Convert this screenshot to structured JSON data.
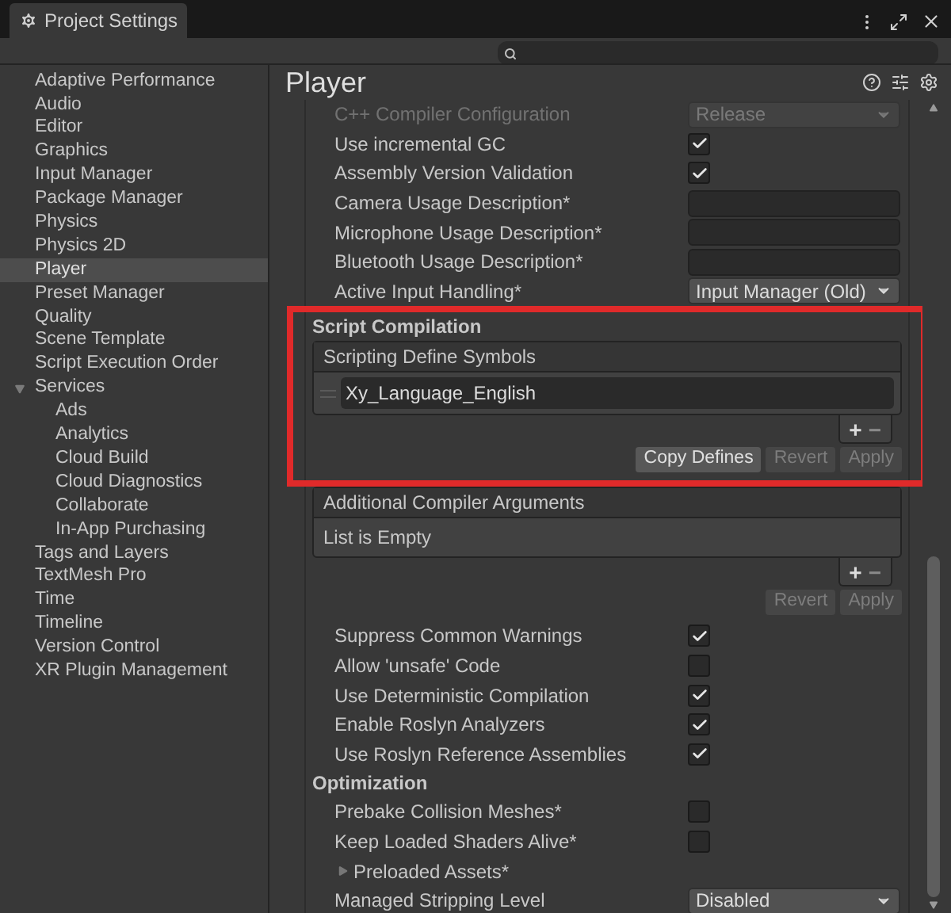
{
  "window": {
    "title": "Project Settings"
  },
  "sidebar": {
    "items": [
      {
        "label": "Adaptive Performance",
        "selected": false
      },
      {
        "label": "Audio",
        "selected": false
      },
      {
        "label": "Editor",
        "selected": false
      },
      {
        "label": "Graphics",
        "selected": false
      },
      {
        "label": "Input Manager",
        "selected": false
      },
      {
        "label": "Package Manager",
        "selected": false
      },
      {
        "label": "Physics",
        "selected": false
      },
      {
        "label": "Physics 2D",
        "selected": false
      },
      {
        "label": "Player",
        "selected": true
      },
      {
        "label": "Preset Manager",
        "selected": false
      },
      {
        "label": "Quality",
        "selected": false
      },
      {
        "label": "Scene Template",
        "selected": false
      },
      {
        "label": "Script Execution Order",
        "selected": false
      },
      {
        "label": "Services",
        "selected": false,
        "expanded": true,
        "children": [
          {
            "label": "Ads",
            "selected": false
          },
          {
            "label": "Analytics",
            "selected": false
          },
          {
            "label": "Cloud Build",
            "selected": false
          },
          {
            "label": "Cloud Diagnostics",
            "selected": false
          },
          {
            "label": "Collaborate",
            "selected": false
          },
          {
            "label": "In-App Purchasing",
            "selected": false
          }
        ]
      },
      {
        "label": "Tags and Layers",
        "selected": false
      },
      {
        "label": "TextMesh Pro",
        "selected": false
      },
      {
        "label": "Time",
        "selected": false
      },
      {
        "label": "Timeline",
        "selected": false
      },
      {
        "label": "Version Control",
        "selected": false
      },
      {
        "label": "XR Plugin Management",
        "selected": false
      }
    ]
  },
  "content": {
    "title": "Player",
    "sections": [
      {
        "highlighted": false,
        "rows": [
          {
            "kind": "dropdown",
            "label": "C++ Compiler Configuration",
            "value": "Release",
            "disabled": true
          },
          {
            "kind": "checkbox",
            "label": "Use incremental GC",
            "checked": true
          },
          {
            "kind": "checkbox",
            "label": "Assembly Version Validation",
            "checked": true
          },
          {
            "kind": "text",
            "label": "Camera Usage Description*"
          },
          {
            "kind": "text",
            "label": "Microphone Usage Description*"
          },
          {
            "kind": "text",
            "label": "Bluetooth Usage Description*"
          },
          {
            "kind": "dropdown",
            "label": "Active Input Handling*",
            "value": "Input Manager (Old)",
            "disabled": false
          }
        ]
      },
      {
        "highlighted": true,
        "rows": [
          {
            "kind": "heading",
            "label": "Script Compilation"
          },
          {
            "kind": "list",
            "label": "Scripting Define Symbols",
            "entries": [
              "Xy_Language_English"
            ],
            "add": "+",
            "remove": "−",
            "buttons": [
              {
                "label": "Copy Defines",
                "disabled": false
              },
              {
                "label": "Revert",
                "disabled": true
              },
              {
                "label": "Apply",
                "disabled": true
              }
            ]
          }
        ]
      },
      {
        "highlighted": false,
        "rows": [
          {
            "kind": "list",
            "label": "Additional Compiler Arguments",
            "empty": "List is Empty",
            "entries": [],
            "add": "+",
            "remove": "−",
            "buttons": [
              {
                "label": "Revert",
                "disabled": true
              },
              {
                "label": "Apply",
                "disabled": true
              }
            ]
          },
          {
            "kind": "checkbox",
            "label": "Suppress Common Warnings",
            "checked": true
          },
          {
            "kind": "checkbox",
            "label": "Allow 'unsafe' Code",
            "checked": false
          },
          {
            "kind": "checkbox",
            "label": "Use Deterministic Compilation",
            "checked": true
          },
          {
            "kind": "checkbox",
            "label": "Enable Roslyn Analyzers",
            "checked": true
          },
          {
            "kind": "checkbox",
            "label": "Use Roslyn Reference Assemblies",
            "checked": true
          },
          {
            "kind": "heading",
            "label": "Optimization"
          },
          {
            "kind": "checkbox",
            "label": "Prebake Collision Meshes*",
            "checked": false
          },
          {
            "kind": "checkbox",
            "label": "Keep Loaded Shaders Alive*",
            "checked": false
          },
          {
            "kind": "foldout",
            "label": "Preloaded Assets*",
            "expanded": false
          },
          {
            "kind": "dropdown",
            "label": "Managed Stripping Level",
            "value": "Disabled",
            "disabled": false
          }
        ]
      }
    ]
  }
}
